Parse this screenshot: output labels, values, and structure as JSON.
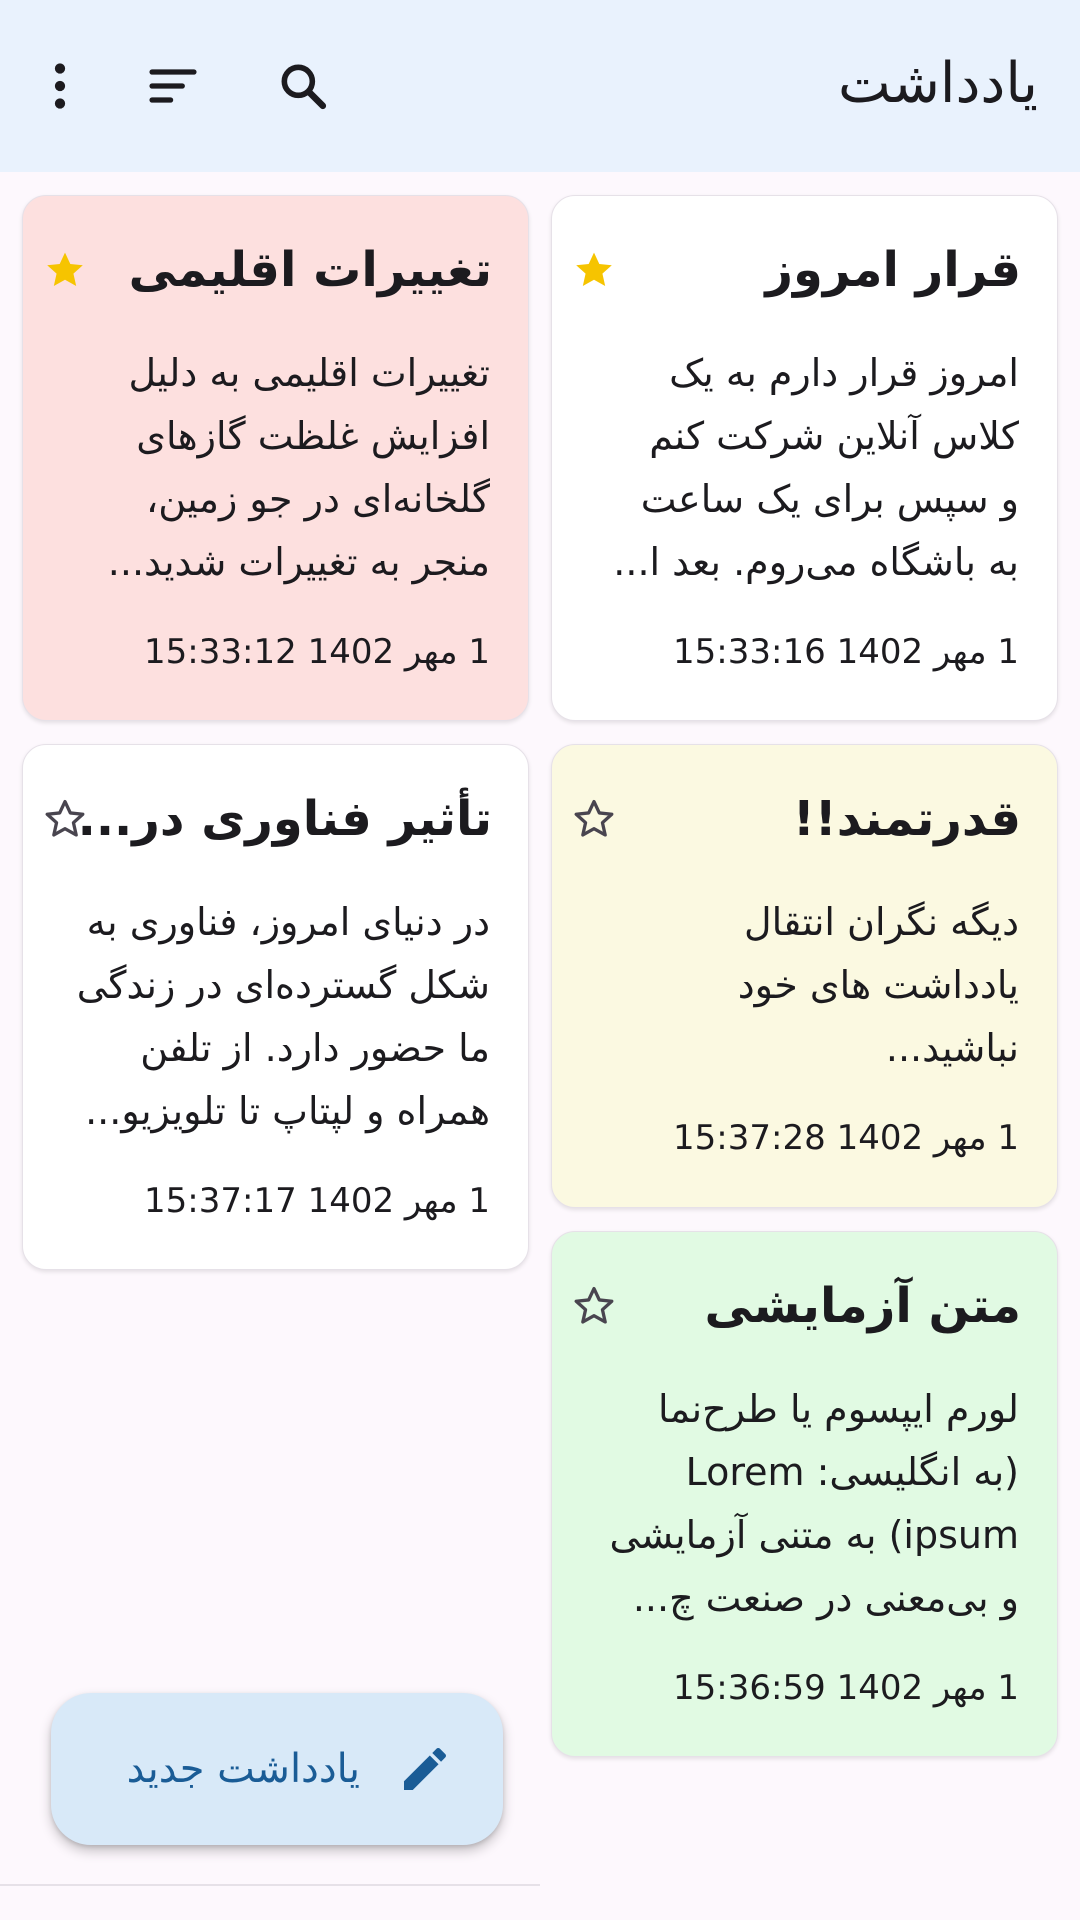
{
  "app_bar": {
    "title": "یادداشت",
    "icons": [
      "search-icon",
      "sort-icon",
      "more-vert-icon"
    ]
  },
  "colors": {
    "app_bar_bg": "#e9f2fd",
    "star_filled": "#f6c400",
    "fab_bg": "#d8e9f8",
    "fab_text": "#1a5c96"
  },
  "notes": [
    {
      "title": "قرار امروز",
      "starred": true,
      "color": "#ffffff",
      "body_lines": [
        "امروز قرار دارم به یک",
        "کلاس آنلاین شرکت کنم",
        "و سپس برای یک ساعت",
        "به باشگاه می‌روم. بعد ا..."
      ],
      "date": "1 مهر 1402 15:33:16"
    },
    {
      "title": "تغییرات اقلیمی",
      "starred": true,
      "color": "#fde0df",
      "body_lines": [
        "تغییرات اقلیمی به دلیل",
        "افزایش غلظت گازهای",
        "گلخانه‌ای در جو زمین،",
        "منجر به تغییرات شدید..."
      ],
      "date": "1 مهر 1402 15:33:12"
    },
    {
      "title": "قدرتمند!!",
      "starred": false,
      "color": "#fbf9e1",
      "body_lines": [
        "دیگه نگران انتقال",
        "یادداشت های خود",
        "نباشید..."
      ],
      "date": "1 مهر 1402 15:37:28"
    },
    {
      "title": "تأثیر فناوری در...",
      "starred": false,
      "color": "#ffffff",
      "body_lines": [
        "در دنیای امروز، فناوری به",
        "شکل گسترده‌ای در زندگی",
        "ما حضور دارد. از تلفن",
        "همراه و لپتاپ تا تلویزیو..."
      ],
      "date": "1 مهر 1402 15:37:17"
    },
    {
      "title": "متن آزمایشی",
      "starred": false,
      "color": "#e1fae3",
      "body_lines": [
        "لورم ایپسوم یا طرح‌نما",
        "(به انگلیسی: Lorem",
        "ipsum) به متنی آزمایشی",
        "و بی‌معنی در صنعت چ..."
      ],
      "date": "1 مهر 1402 15:36:59"
    }
  ],
  "fab": {
    "label": "یادداشت جدید",
    "icon": "edit-pencil-icon"
  }
}
